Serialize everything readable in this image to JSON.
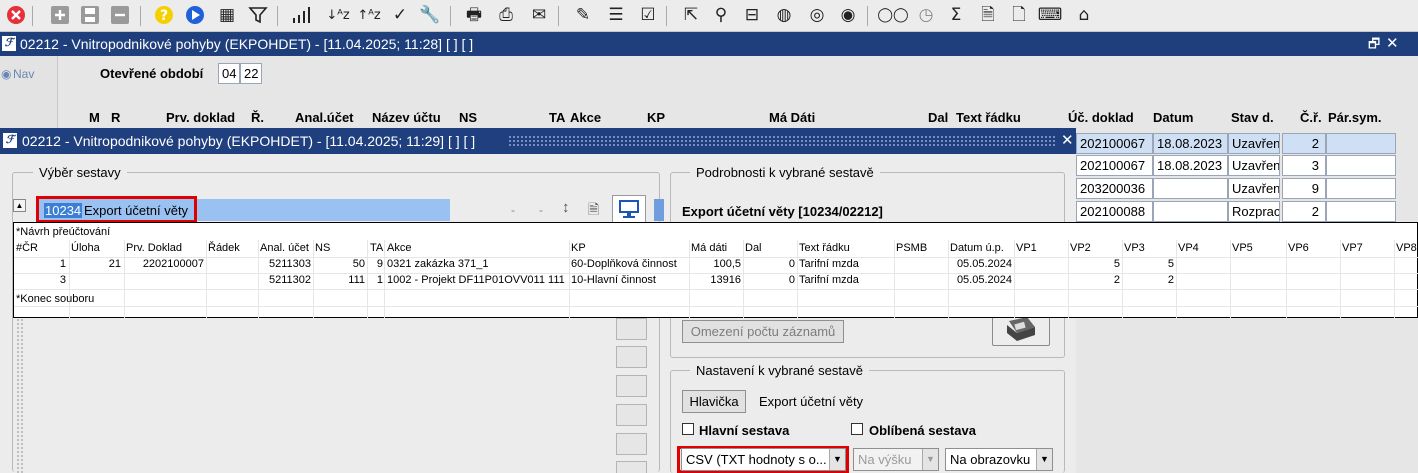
{
  "toolbar": {
    "icons": [
      "close-icon",
      "add-icon",
      "save-icon",
      "remove-icon",
      "help-icon",
      "play-icon",
      "calendar-icon",
      "filter-icon",
      "chart-bars-icon",
      "sort-az-icon",
      "sort-za-icon",
      "check-icon",
      "wrench-icon",
      "print-icon",
      "print-preview-icon",
      "mail-icon",
      "edit-icon",
      "list-icon",
      "checklist-icon",
      "export-icon",
      "attach-icon",
      "signpost-icon",
      "globe-icon",
      "compass-icon",
      "eye-icon",
      "glasses-icon",
      "clock-icon",
      "sigma-icon",
      "excel-icon",
      "code-file-icon",
      "keyboard-icon",
      "user-book-icon"
    ],
    "accent_close": "#e8303a",
    "accent_help": "#f5d000",
    "accent_play": "#2060d8"
  },
  "back_window": {
    "title": "02212 - Vnitropodnikové pohyby (EKPOHDET) - [11.04.2025; 11:28]  [ ]  [ ]",
    "nav_label": "Nav",
    "period_label": "Otevřené období",
    "period_month": "04",
    "period_year": "22",
    "columns": [
      "M",
      "R",
      "Prv. doklad",
      "Ř.",
      "Anal.účet",
      "Název účtu",
      "NS",
      "TA",
      "Akce",
      "KP",
      "Má Dáti",
      "Dal",
      "Text řádku",
      "Úč. doklad",
      "Datum",
      "Stav d.",
      "Č.ř.",
      "Pár.sym."
    ],
    "rows": [
      {
        "doklad": "202100067",
        "datum": "18.08.2023",
        "stav": "Uzavřen",
        "cr": "2"
      },
      {
        "doklad": "202100067",
        "datum": "18.08.2023",
        "stav": "Uzavřen",
        "cr": "3"
      },
      {
        "doklad": "203200036",
        "datum": "",
        "stav": "Uzavřen",
        "cr": "9"
      },
      {
        "doklad": "202100088",
        "datum": "",
        "stav": "Rozprac",
        "cr": "2"
      }
    ]
  },
  "front_window": {
    "title": "02212 - Vnitropodnikové pohyby (EKPOHDET) - [11.04.2025; 11:29]  [ ]  [ ]",
    "selection_group": "Výběr sestavy",
    "selected_code": "10234",
    "selected_name": "Export účetní věty",
    "details_group": "Podrobnosti k vybrané sestavě",
    "details_title": "Export účetní věty [10234/02212]",
    "limit_button": "Omezení počtu záznamů",
    "settings_group": "Nastavení k vybrané sestavě",
    "header_button": "Hlavička",
    "header_value": "Export účetní věty",
    "main_report_label": "Hlavní sestava",
    "favorite_label": "Oblíbená sestava",
    "format_value": "CSV (TXT hodnoty s o...",
    "orientation_value": "Na výšku",
    "output_value": "Na obrazovku"
  },
  "preview": {
    "line1": "*Návrh přeúčtování",
    "headers": [
      "#ČR",
      "Úloha",
      "Prv. Doklad",
      "Řádek",
      "Anal. účet",
      "NS",
      "TA",
      "Akce",
      "KP",
      "Má dáti",
      "Dal",
      "Text řádku",
      "PSMB",
      "Datum ú.p.",
      "VP1",
      "VP2",
      "VP3",
      "VP4",
      "VP5",
      "VP6",
      "VP7",
      "VP8"
    ],
    "rows": [
      [
        "1",
        "21",
        "2202100007",
        "",
        "5211303",
        "50",
        "9",
        "0321 zakázka 371_1",
        "60-Doplňková činnost",
        "100,5",
        "0",
        "Tarifní mzda",
        "",
        "05.05.2024",
        "",
        "5",
        "5",
        "",
        "",
        "",
        "",
        ""
      ],
      [
        "3",
        "",
        "",
        "",
        "5211302",
        "111",
        "1",
        "1002 - Projekt DF11P01OVV011 111",
        "10-Hlavní činnost",
        "13916",
        "0",
        "Tarifní mzda",
        "",
        "05.05.2024",
        "",
        "2",
        "2",
        "",
        "",
        "",
        "",
        ""
      ]
    ],
    "footer": "*Konec souboru"
  }
}
